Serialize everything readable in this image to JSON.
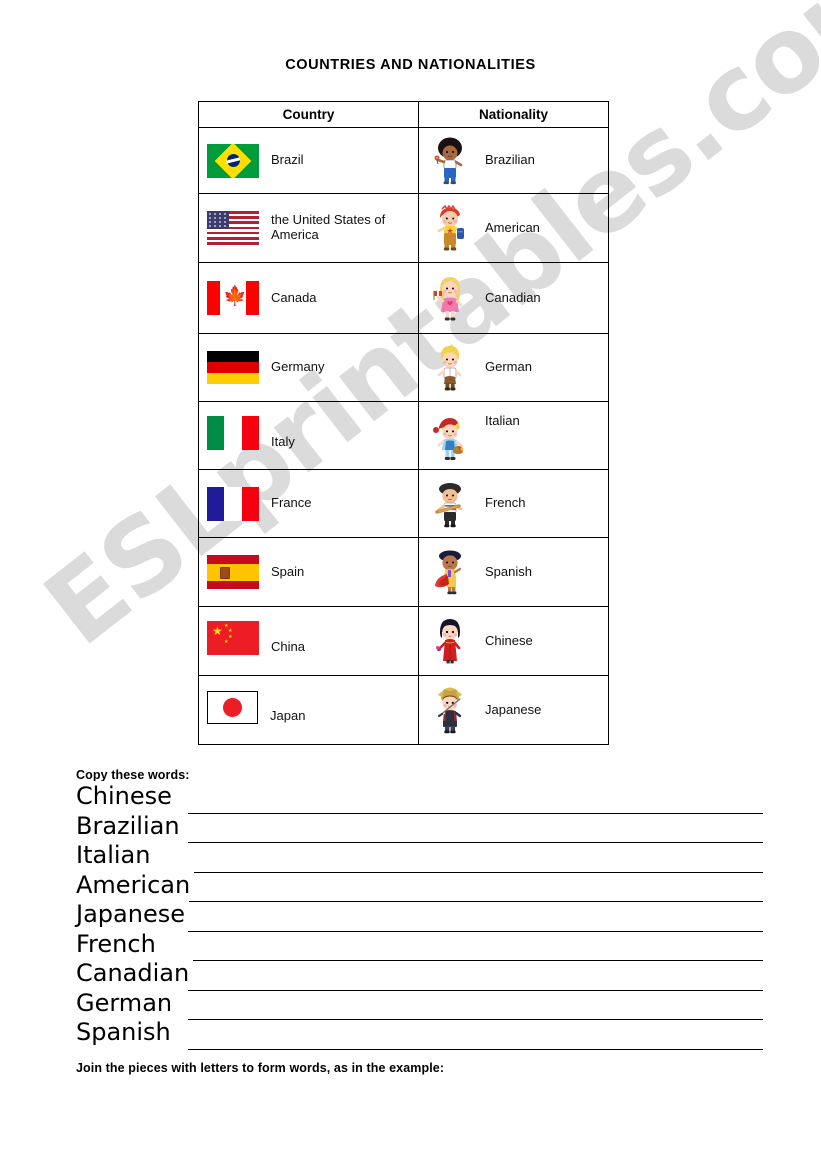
{
  "page": {
    "title": "COUNTRIES AND NATIONALITIES",
    "watermark": "ESLprintables.com"
  },
  "table": {
    "headers": {
      "country": "Country",
      "nationality": "Nationality"
    },
    "rows": [
      {
        "country": "Brazil",
        "nationality": "Brazilian",
        "flag": "flag-brazil",
        "figure": "brazilian-figure"
      },
      {
        "country": "the United States of America",
        "nationality": "American",
        "flag": "flag-usa",
        "figure": "american-figure"
      },
      {
        "country": "Canada",
        "nationality": "Canadian",
        "flag": "flag-canada",
        "figure": "canadian-figure"
      },
      {
        "country": "Germany",
        "nationality": "German",
        "flag": "flag-germany",
        "figure": "german-figure"
      },
      {
        "country": "Italy",
        "nationality": "Italian",
        "flag": "flag-italy",
        "figure": "italian-figure"
      },
      {
        "country": "France",
        "nationality": "French",
        "flag": "flag-france",
        "figure": "french-figure"
      },
      {
        "country": "Spain",
        "nationality": "Spanish",
        "flag": "flag-spain",
        "figure": "spanish-figure"
      },
      {
        "country": "China",
        "nationality": "Chinese",
        "flag": "flag-china",
        "figure": "chinese-figure"
      },
      {
        "country": "Japan",
        "nationality": "Japanese",
        "flag": "flag-japan",
        "figure": "japanese-figure"
      }
    ]
  },
  "copy_exercise": {
    "heading": "Copy these words:",
    "words": [
      "Chinese",
      "Brazilian",
      "Italian",
      "American",
      "Japanese",
      "French",
      "Canadian",
      "German",
      "Spanish"
    ]
  },
  "join_exercise": {
    "instruction": "Join the pieces with letters to form words, as in the example:"
  },
  "colors": {
    "ink": "#000000",
    "paper": "#ffffff",
    "watermark": "rgba(0,0,0,0.14)",
    "brazil_green": "#009b3a",
    "brazil_yellow": "#ffdf00",
    "brazil_blue": "#002776",
    "usa_red": "#b22234",
    "usa_blue": "#3c3b6e",
    "canada_red": "#ff0000",
    "germany_black": "#000000",
    "germany_red": "#dd0000",
    "germany_gold": "#ffce00",
    "italy_green": "#008c45",
    "italy_red": "#f4000f",
    "france_blue": "#1f1a97",
    "france_red": "#f4000f",
    "spain_red": "#c60b1e",
    "spain_yellow": "#ffc400",
    "china_red": "#ee1c25",
    "china_yellow": "#ffde00",
    "japan_red": "#ee1c25"
  }
}
